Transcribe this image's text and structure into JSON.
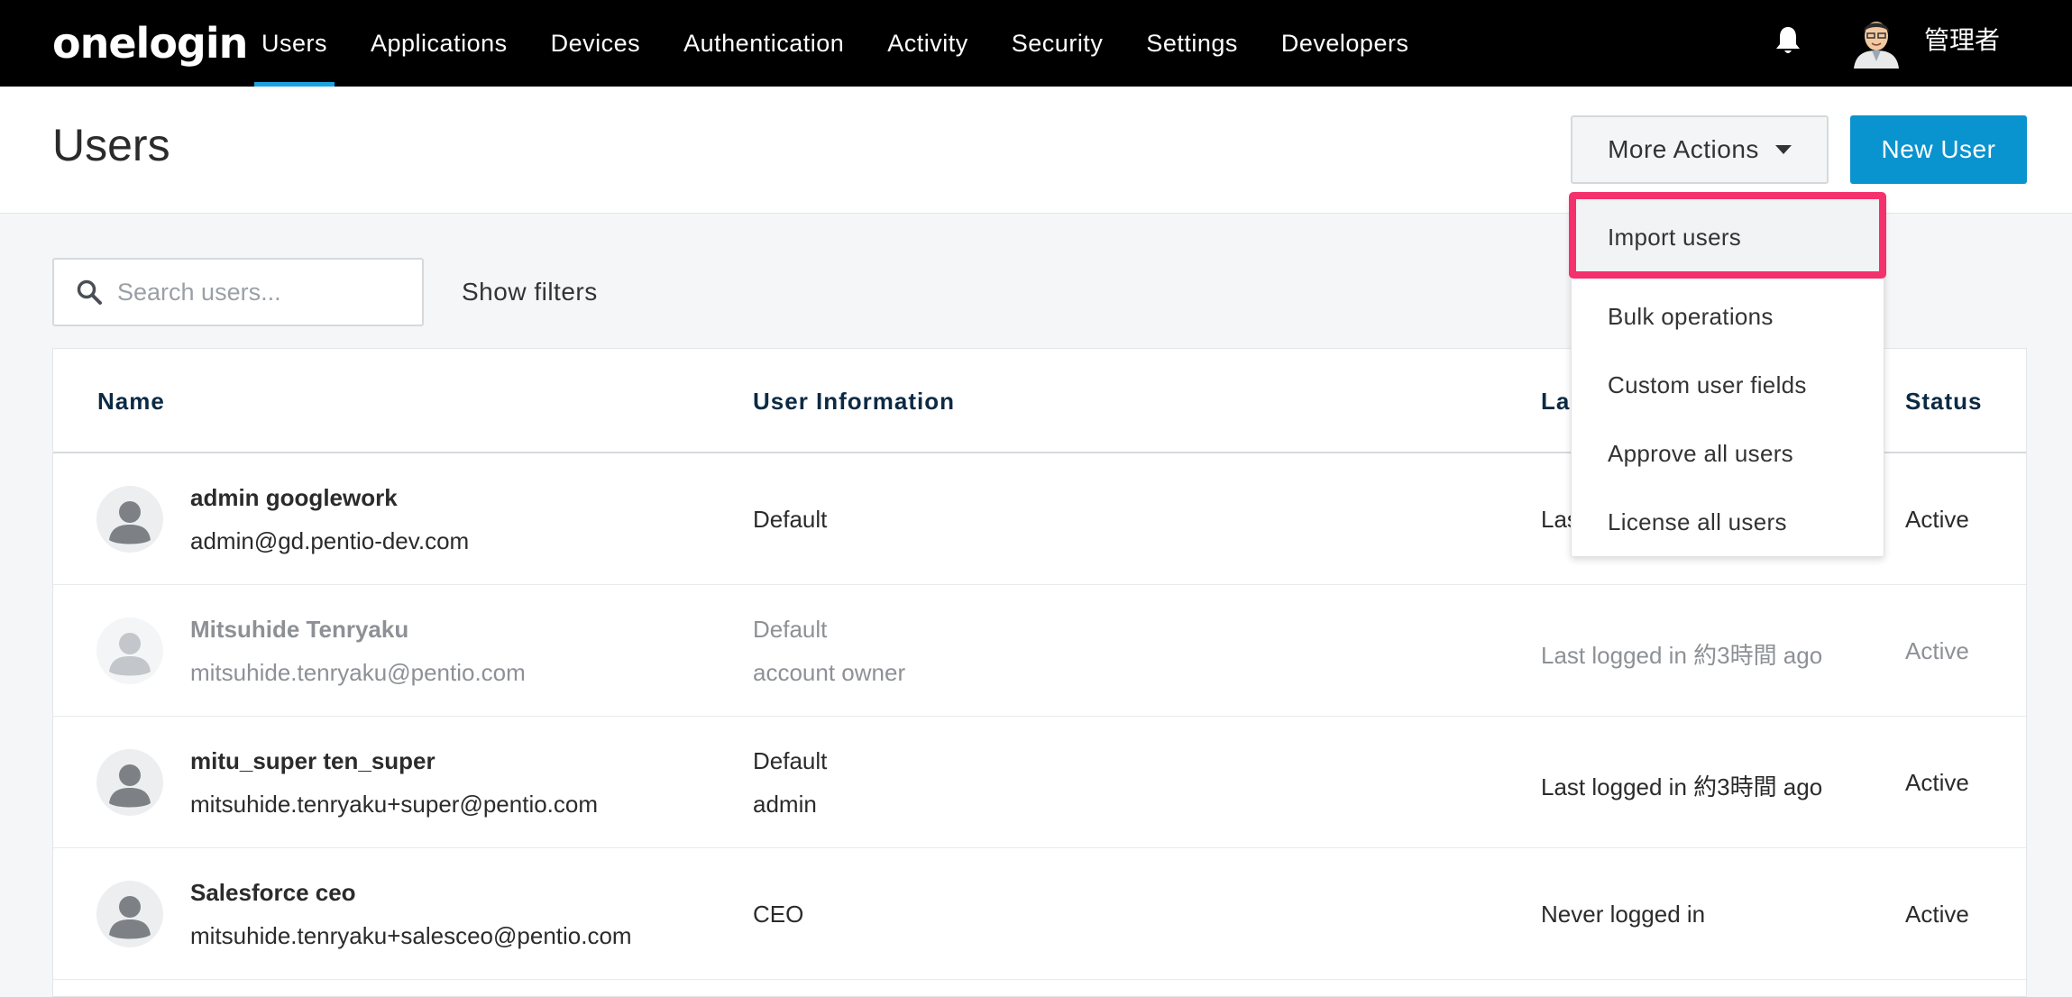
{
  "topnav": {
    "logo": "onelogin",
    "items": [
      {
        "label": "Users",
        "active": true
      },
      {
        "label": "Applications",
        "active": false
      },
      {
        "label": "Devices",
        "active": false
      },
      {
        "label": "Authentication",
        "active": false
      },
      {
        "label": "Activity",
        "active": false
      },
      {
        "label": "Security",
        "active": false
      },
      {
        "label": "Settings",
        "active": false
      },
      {
        "label": "Developers",
        "active": false
      }
    ],
    "bell_icon": "bell-icon",
    "admin_name": "管理者",
    "accent_color": "#1ba2e0"
  },
  "header": {
    "title": "Users",
    "more_actions_label": "More Actions",
    "new_user_label": "New User",
    "new_user_color": "#0a94cf"
  },
  "search": {
    "placeholder": "Search users...",
    "value": "",
    "show_filters_label": "Show filters"
  },
  "table": {
    "columns": {
      "name": "Name",
      "user_information": "User Information",
      "last_login": "La",
      "status": "Status"
    },
    "rows": [
      {
        "name": "admin googlework",
        "email": "admin@gd.pentio-dev.com",
        "info1": "Default",
        "info2": "",
        "last_login": "Las",
        "status": "Active",
        "dimmed": false
      },
      {
        "name": "Mitsuhide Tenryaku",
        "email": "mitsuhide.tenryaku@pentio.com",
        "info1": "Default",
        "info2": "account owner",
        "last_login": "Last logged in 約3時間 ago",
        "status": "Active",
        "dimmed": true
      },
      {
        "name": "mitu_super ten_super",
        "email": "mitsuhide.tenryaku+super@pentio.com",
        "info1": "Default",
        "info2": "admin",
        "last_login": "Last logged in 約3時間 ago",
        "status": "Active",
        "dimmed": false
      },
      {
        "name": "Salesforce ceo",
        "email": "mitsuhide.tenryaku+salesceo@pentio.com",
        "info1": "CEO",
        "info2": "",
        "last_login": "Never logged in",
        "status": "Active",
        "dimmed": false
      }
    ]
  },
  "dropdown": {
    "items": [
      {
        "label": "Import users",
        "highlighted": true
      },
      {
        "label": "Bulk operations",
        "highlighted": false
      },
      {
        "label": "Custom user fields",
        "highlighted": false
      },
      {
        "label": "Approve all users",
        "highlighted": false
      },
      {
        "label": "License all users",
        "highlighted": false
      }
    ],
    "highlight_color": "#f4306d"
  }
}
